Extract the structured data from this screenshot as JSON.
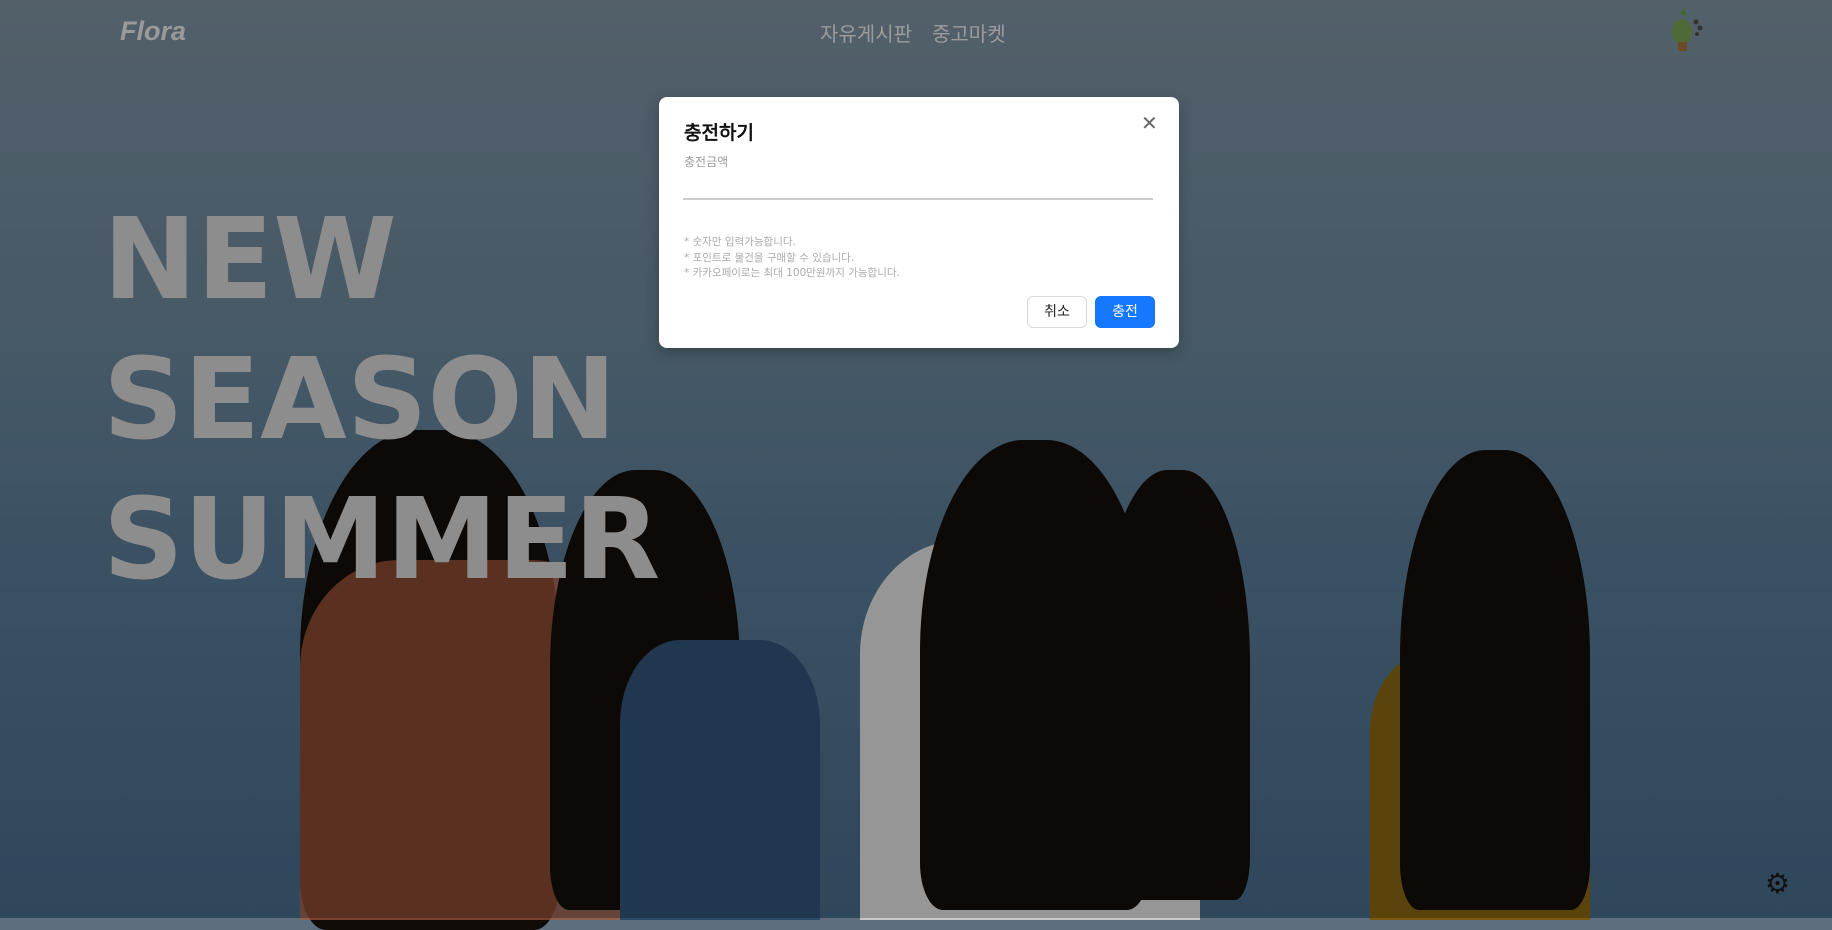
{
  "header": {
    "logo": "Flora",
    "nav": [
      "자유게시판",
      "중고마켓"
    ]
  },
  "hero": {
    "lines": [
      "NEW",
      "SEASON",
      "SUMMER"
    ]
  },
  "modal": {
    "title": "충전하기",
    "field_label": "충전금액",
    "amount_value": "",
    "notes": [
      "* 숫자만 입력가능합니다.",
      "* 포인트로 물건을 구매할 수 있습니다.",
      "* 카카오페이로는 최대 100만원까지 가능합니다."
    ],
    "cancel_label": "취소",
    "confirm_label": "충전"
  },
  "colors": {
    "primary": "#1677ff"
  }
}
